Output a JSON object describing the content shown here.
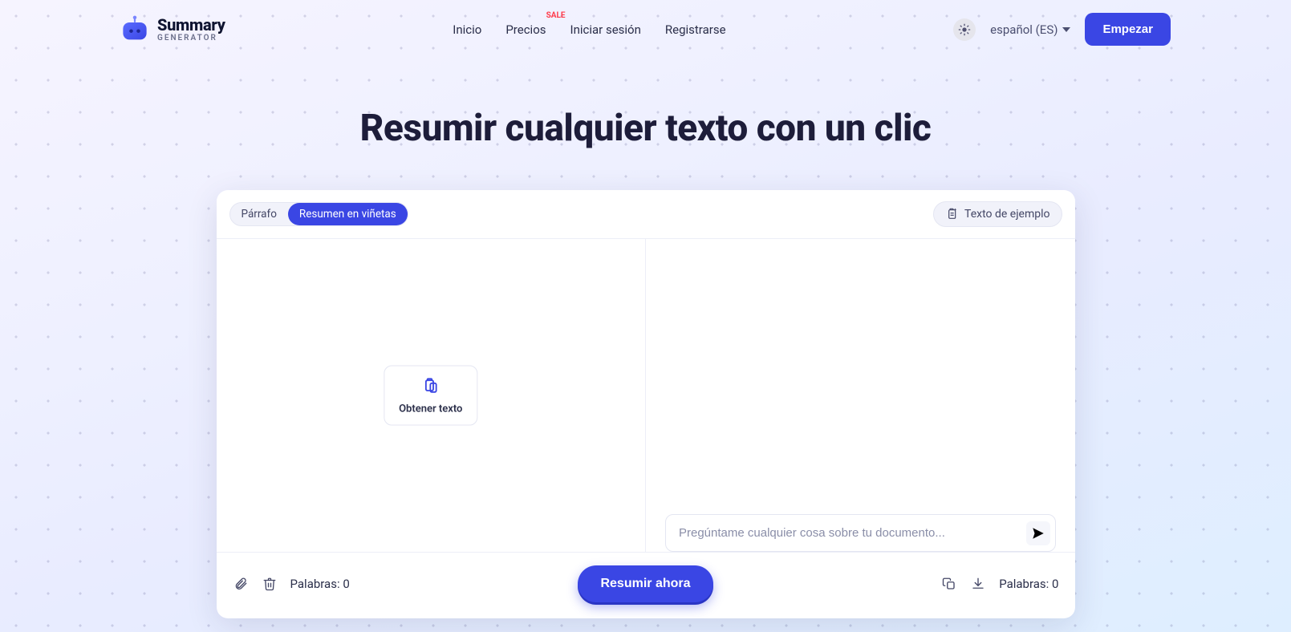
{
  "brand": {
    "line1": "Summary",
    "line2": "GENERATOR"
  },
  "nav": {
    "home": "Inicio",
    "pricing": "Precios",
    "pricing_badge": "SALE",
    "login": "Iniciar sesión",
    "signup": "Registrarse"
  },
  "header": {
    "language": "español (ES)",
    "cta": "Empezar"
  },
  "hero": {
    "title": "Resumir cualquier texto con un clic"
  },
  "toolbar": {
    "mode_paragraph": "Párrafo",
    "mode_bullets": "Resumen en viñetas",
    "sample_text": "Texto de ejemplo"
  },
  "input_pane": {
    "get_text": "Obtener texto"
  },
  "output_pane": {
    "ask_placeholder": "Pregúntame cualquier cosa sobre tu documento..."
  },
  "footer": {
    "words_left_label": "Palabras:",
    "words_left_count": "0",
    "summarize": "Resumir ahora",
    "words_right_label": "Palabras:",
    "words_right_count": "0"
  }
}
